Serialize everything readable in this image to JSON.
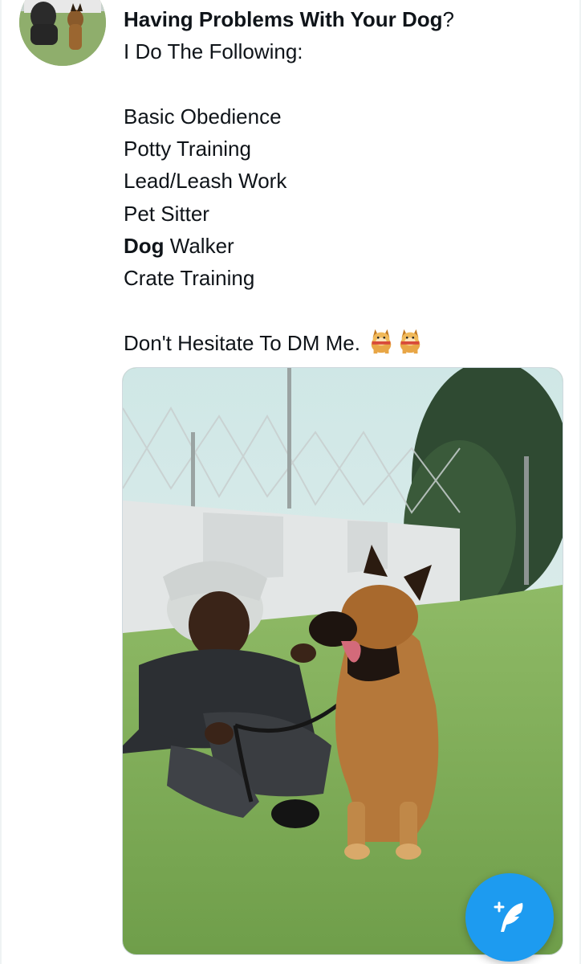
{
  "tweet": {
    "lines": [
      {
        "segments": [
          {
            "text": "Having Problems With Your Dog",
            "bold": true
          },
          {
            "text": "?",
            "bold": false
          }
        ]
      },
      {
        "segments": [
          {
            "text": "I Do The Following:",
            "bold": false
          }
        ]
      },
      {
        "segments": [
          {
            "text": "",
            "bold": false
          }
        ]
      },
      {
        "segments": [
          {
            "text": "Basic Obedience",
            "bold": false
          }
        ]
      },
      {
        "segments": [
          {
            "text": "Potty Training",
            "bold": false
          }
        ]
      },
      {
        "segments": [
          {
            "text": "Lead/Leash Work",
            "bold": false
          }
        ]
      },
      {
        "segments": [
          {
            "text": "Pet Sitter",
            "bold": false
          }
        ]
      },
      {
        "segments": [
          {
            "text": "Dog",
            "bold": true
          },
          {
            "text": " Walker",
            "bold": false
          }
        ]
      },
      {
        "segments": [
          {
            "text": "Crate Training",
            "bold": false
          }
        ]
      },
      {
        "segments": [
          {
            "text": "",
            "bold": false
          }
        ]
      },
      {
        "segments": [
          {
            "text": "Don't Hesitate To DM Me. ",
            "bold": false
          }
        ],
        "emojis": [
          "dog-emoji",
          "dog-emoji"
        ]
      }
    ]
  },
  "media": {
    "description_icon": "photo-man-with-german-shepherd"
  },
  "compose_button": {
    "icon": "compose-feather-plus-icon",
    "color": "#1d9bf0"
  },
  "avatar": {
    "icon": "profile-avatar-man-with-dog"
  }
}
